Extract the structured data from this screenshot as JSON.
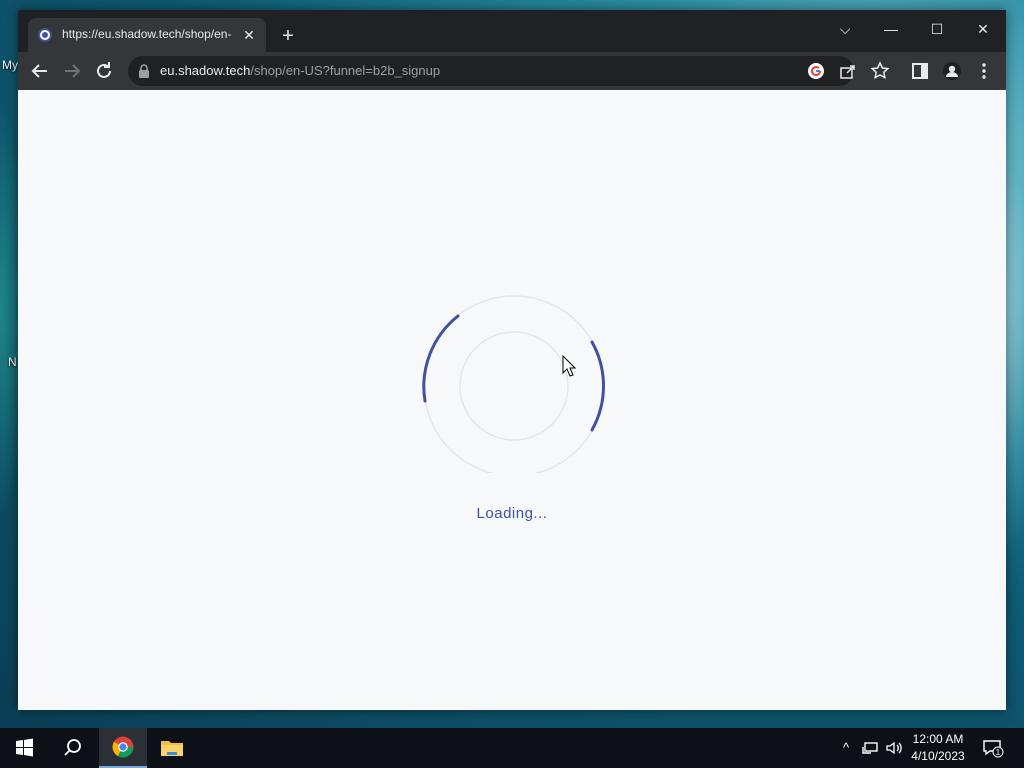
{
  "desktop": {
    "labels": [
      "My",
      "N"
    ]
  },
  "browser": {
    "tab": {
      "title": "https://eu.shadow.tech/shop/en-",
      "close": "✕"
    },
    "new_tab": "+",
    "window_controls": {
      "dropdown": "⌵",
      "minimize": "—",
      "maximize": "☐",
      "close": "✕"
    },
    "address": {
      "host": "eu.shadow.tech",
      "path": "/shop/en-US?funnel=b2b_signup"
    }
  },
  "page": {
    "loading_text": "Loading...",
    "accent": "#3f51a0"
  },
  "taskbar": {
    "clock_time": "12:00 AM",
    "clock_date": "4/10/2023",
    "notification_count": "1",
    "tray_chevron": "^"
  }
}
